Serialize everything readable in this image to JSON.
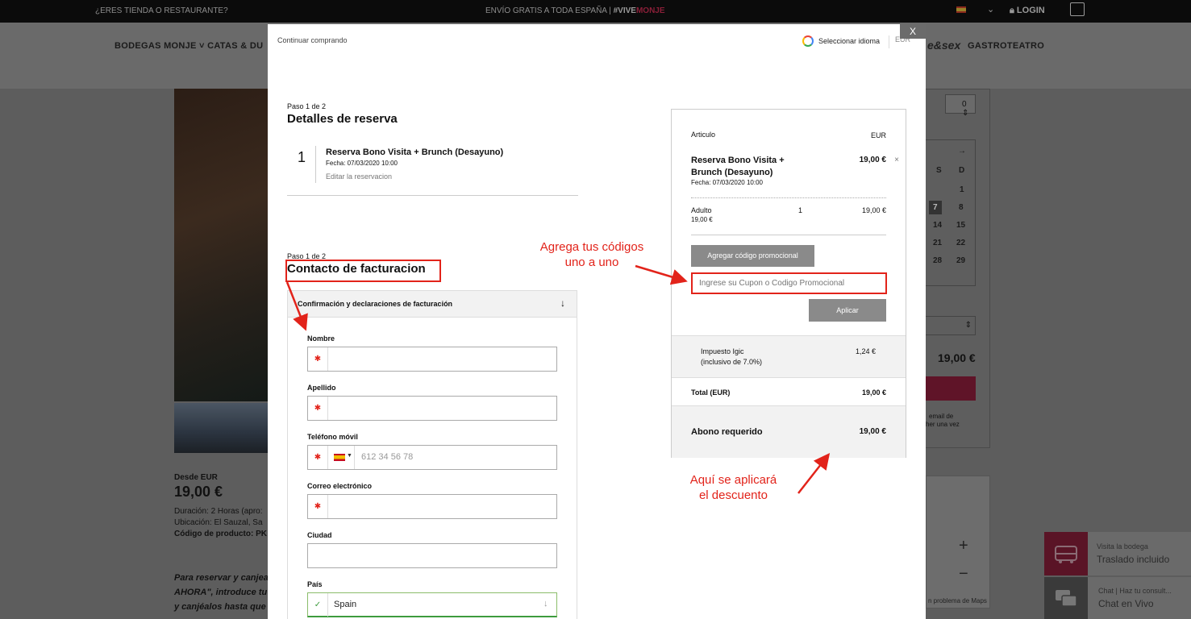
{
  "background": {
    "topbar": {
      "store_link": "¿ERES TIENDA O RESTAURANTE?",
      "shipping_text": "ENVÍO GRATIS A TODA ESPAÑA",
      "separator": "|",
      "hashtag_prefix": "#VIVE",
      "hashtag_suffix": "MONJE",
      "login_label": "LOGIN"
    },
    "nav": {
      "item1": "BODEGAS MONJE ˅   CATAS & DU",
      "item2": "GASTROTEATRO",
      "logo_partial": "e&sex"
    },
    "product": {
      "from_label": "Desde EUR",
      "price": "19,00 €",
      "duration": "Duración: 2 Horas (apro:",
      "location": "Ubicación: El Sauzal, Sa",
      "code": "Código de producto: PK",
      "promo_line1": "Para reservar y canjea",
      "promo_line2": "AHORA\", introduce tu",
      "promo_line3": "y canjéalos hasta que"
    },
    "right_panel": {
      "qty": "0",
      "calendar_days": [
        "S",
        "D",
        "1",
        "7",
        "8",
        "14",
        "15",
        "21",
        "22",
        "28",
        "29"
      ],
      "price": "19,00 €",
      "note1": "email de",
      "note2": "her una vez"
    },
    "map": {
      "zoom_in": "+",
      "zoom_out": "−",
      "terms": "n problema de Maps"
    },
    "chat_widgets": [
      {
        "sub": "Visita la bodega",
        "title": "Traslado incluido"
      },
      {
        "sub": "Chat | Haz tu consult...",
        "title": "Chat en Vivo"
      }
    ]
  },
  "modal": {
    "close_label": "X",
    "continue_shopping": "Continuar comprando",
    "language_selector": "Seleccionar idioma",
    "currency": "EUR",
    "booking_section": {
      "step": "Paso 1 de 2",
      "title": "Detalles de reserva",
      "item_number": "1",
      "item_title": "Reserva Bono Visita + Brunch (Desayuno)",
      "item_date": "Fecha: 07/03/2020   10:00",
      "edit_link": "Editar la reservacion"
    },
    "billing_section": {
      "step": "Paso 1 de 2",
      "title": "Contacto de facturacion",
      "accordion_title": "Confirmación y declaraciones de facturación",
      "accordion_icon": "↓",
      "required_mark": "✱",
      "fields": {
        "first_name": "Nombre",
        "last_name": "Apellido",
        "phone": "Teléfono móvil",
        "phone_placeholder": "612 34 56 78",
        "email": "Correo electrónico",
        "city": "Ciudad",
        "country": "País",
        "country_value": "Spain",
        "country_check": "✓",
        "country_arrow": "↓"
      }
    },
    "summary": {
      "col_item": "Articulo",
      "col_currency": "EUR",
      "item_title": "Reserva Bono Visita + Brunch (Desayuno)",
      "item_date": "Fecha: 07/03/2020   10:00",
      "item_price": "19,00 €",
      "remove_icon": "×",
      "adult_label": "Adulto",
      "adult_unit_price": "19,00 €",
      "adult_qty": "1",
      "adult_total": "19,00 €",
      "promo_button": "Agregar código promocional",
      "promo_placeholder": "Ingrese su Cupon o Codigo Promocional",
      "apply_button": "Aplicar",
      "tax_label": "Impuesto Igic",
      "tax_detail": "(inclusivo de 7.0%)",
      "tax_value": "1,24 €",
      "total_label": "Total (EUR)",
      "total_value": "19,00 €",
      "deposit_label": "Abono requerido",
      "deposit_value": "19,00 €"
    }
  },
  "annotations": {
    "promo_hint_line1": "Agrega tus códigos",
    "promo_hint_line2": "uno a uno",
    "discount_hint_line1": "Aquí se aplicará",
    "discount_hint_line2": "el descuento",
    "color": "#e2231a"
  }
}
